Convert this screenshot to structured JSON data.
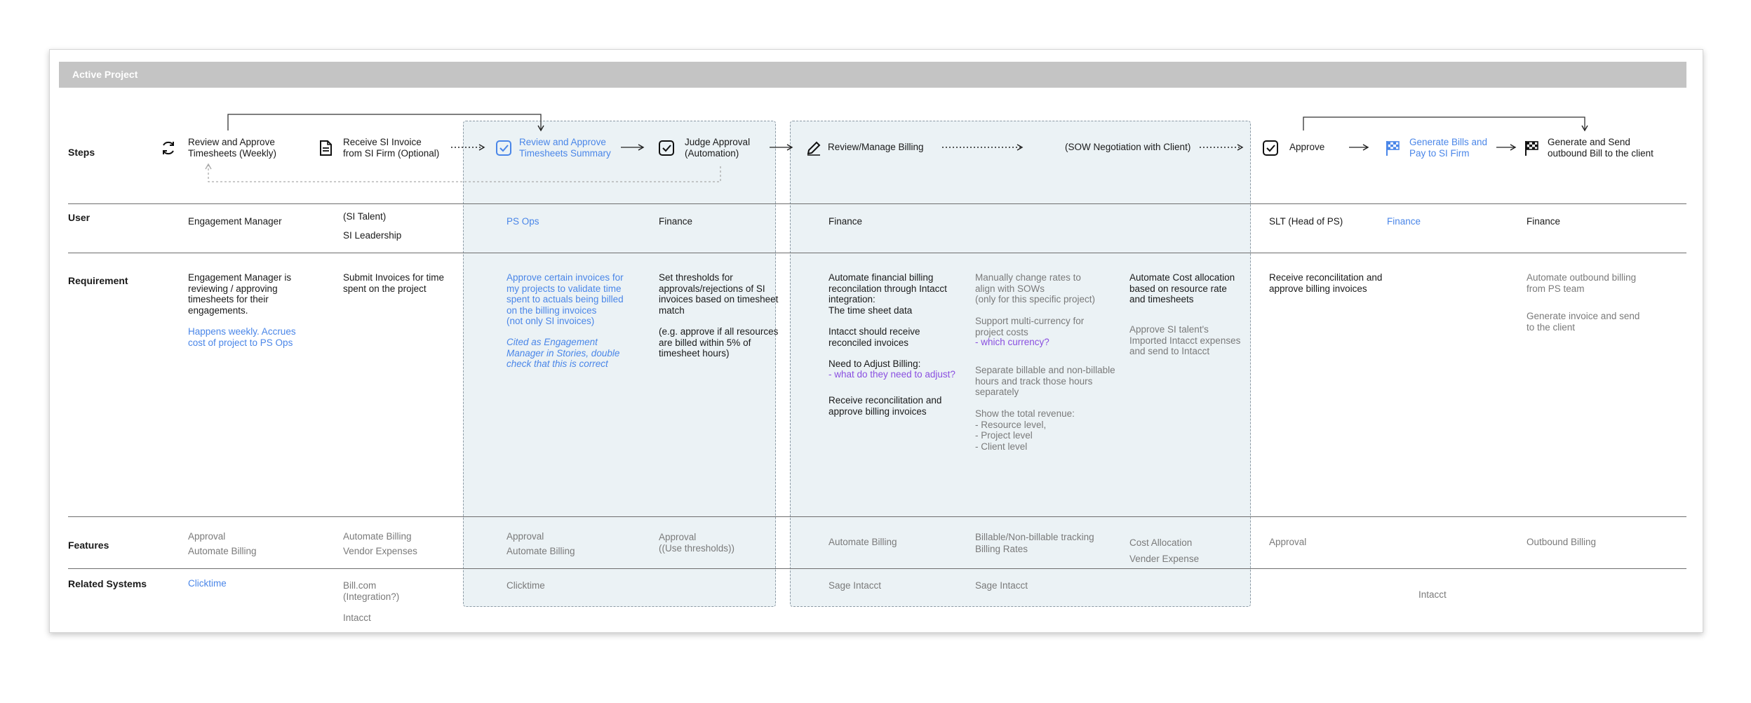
{
  "header": {
    "title": "Active Project"
  },
  "row_labels": {
    "steps": "Steps",
    "user": "User",
    "requirement": "Requirement",
    "features": "Features",
    "related": "Related Systems"
  },
  "steps": {
    "s1": "Review and Approve\nTimesheets (Weekly)",
    "s2": "Receive SI Invoice\nfrom SI Firm (Optional)",
    "s3": "Review and Approve\nTimesheets Summary",
    "s4": "Judge Approval\n(Automation)",
    "s5": "Review/Manage Billing",
    "s6": "(SOW Negotiation with Client)",
    "s7": "Approve",
    "s8": "Generate Bills and\nPay to SI Firm",
    "s9": "Generate and Send\noutbound Bill to the client"
  },
  "users": {
    "c1": "Engagement Manager",
    "c2a": "(SI Talent)",
    "c2b": "SI Leadership",
    "c3": "PS Ops",
    "c4": "Finance",
    "c5": "Finance",
    "c8": "SLT (Head of PS)",
    "c9": "Finance",
    "c10": "Finance"
  },
  "requirements": {
    "c1_main": "Engagement Manager is\nreviewing / approving\ntimesheets for their\nengagements.",
    "c1_note": "Happens weekly. Accrues\ncost of project to PS Ops",
    "c2": "Submit Invoices for time\nspent on the project",
    "c3_main": "Approve certain invoices for\nmy projects to validate time\nspent to actuals being billed\non the billing invoices\n(not only SI invoices)",
    "c3_note": "Cited as Engagement\nManager in Stories, double\ncheck that this is correct",
    "c4_a": "Set thresholds for\napprovals/rejections of SI\ninvoices based on timesheet\nmatch",
    "c4_b": "(e.g. approve if all resources\nare billed within 5% of\ntimesheet hours)",
    "c5_a": "Automate financial billing\nreconcilation through Intacct\nintegration:\nThe time sheet data",
    "c5_b": "Intacct should receive\nreconciled invoices",
    "c5_c": "Need to Adjust Billing:",
    "c5_c2": "- what do they need to adjust?",
    "c5_d": "Receive reconcilitation and\napprove billing invoices",
    "c6_a": "Manually change rates to\nalign with SOWs\n(only for this specific project)",
    "c6_b": "Support multi-currency for\nproject costs",
    "c6_b2": "- which currency?",
    "c6_c": "Separate billable and non-billable\nhours and track those hours\nseparately",
    "c6_d": "Show the total revenue:\n- Resource level,\n- Project level\n- Client level",
    "c7_a": "Automate Cost allocation\nbased on resource rate\nand timesheets",
    "c7_b": "Approve SI talent's\nImported Intacct expenses\nand send to Intacct",
    "c8": "Receive reconcilitation and\napprove billing invoices",
    "c10_a": "Automate outbound billing\nfrom PS team",
    "c10_b": "Generate invoice and send\nto the client"
  },
  "features": {
    "c1": "Approval\nAutomate Billing",
    "c2": "Automate Billing\nVendor Expenses",
    "c3": "Approval\nAutomate Billing",
    "c4": "Approval\n((Use thresholds))",
    "c5": "Automate Billing",
    "c6": "Billable/Non-billable tracking\nBilling Rates",
    "c7a": "Cost Allocation",
    "c7b": "Vender Expense",
    "c8": "Approval",
    "c10": "Outbound Billing"
  },
  "related": {
    "c1": "Clicktime",
    "c2a": "Bill.com\n(Integration?)",
    "c2b": "Intacct",
    "c3": "Clicktime",
    "c5": "Sage Intacct",
    "c6": "Sage Intacct",
    "c9": "Intacct"
  },
  "colors": {
    "link_blue": "#4a86e8",
    "question_purple": "#8a4fe0",
    "band_fill": "#ebf2f5",
    "header_gray": "#c4c4c4"
  },
  "icons": {
    "s1": "refresh-icon",
    "s2": "document-icon",
    "s3": "checkbox-icon",
    "s4": "checkbox-icon",
    "s5": "pencil-icon",
    "s7": "checkbox-icon",
    "s8": "checkered-flag-icon",
    "s9": "checkered-flag-icon"
  }
}
